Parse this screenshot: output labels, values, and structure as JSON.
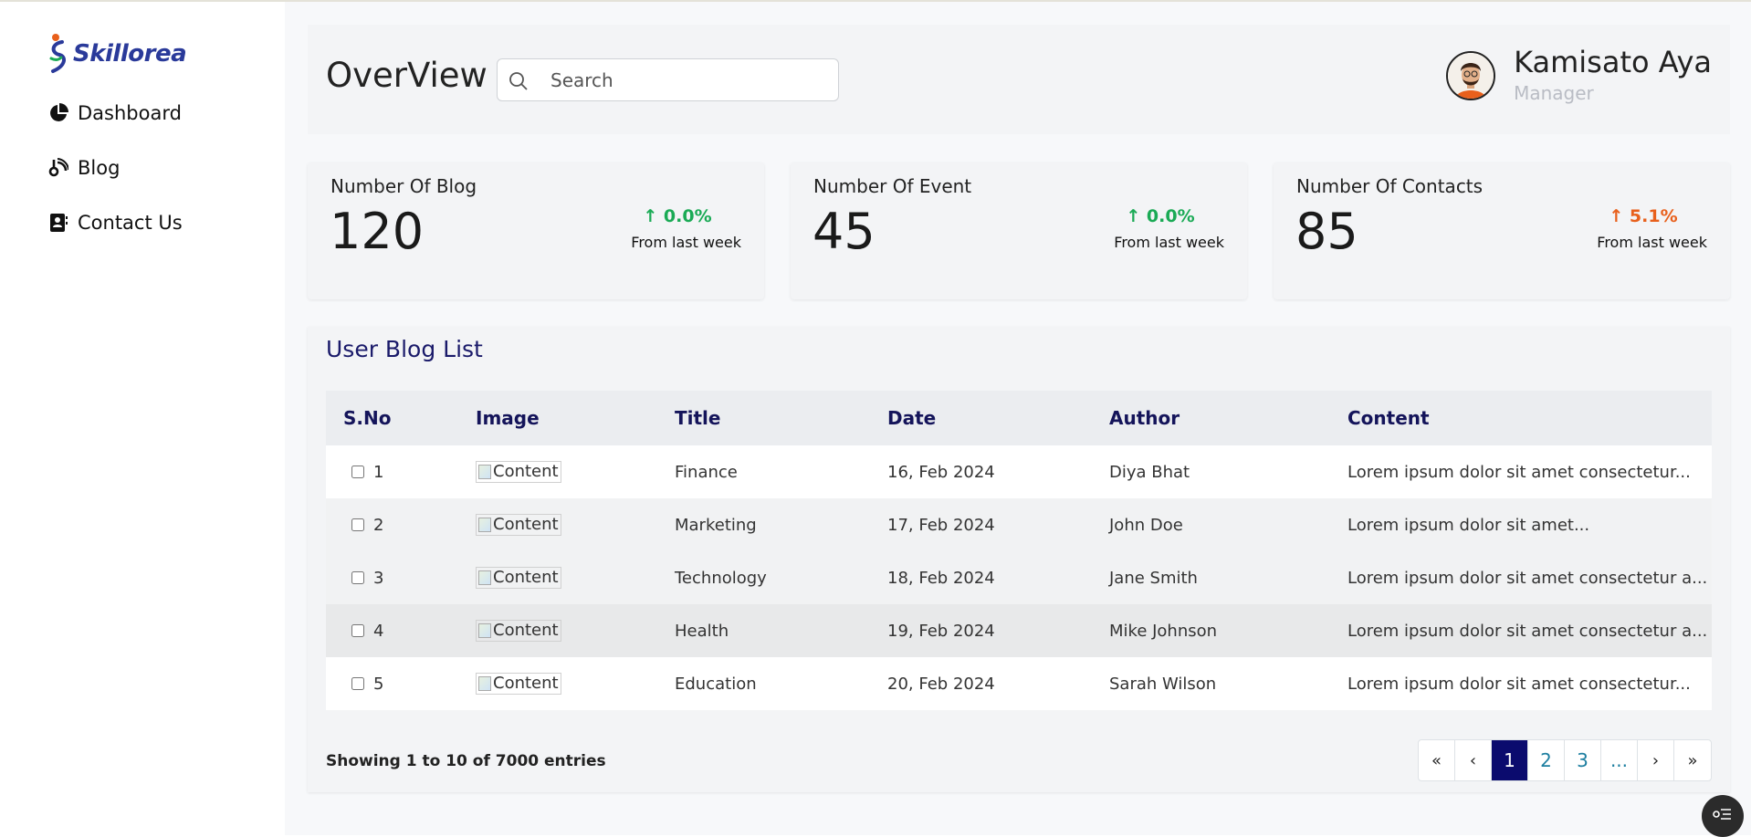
{
  "brand": {
    "logo_text": "Skillorea"
  },
  "sidebar": {
    "items": [
      {
        "label": "Dashboard",
        "icon": "pie-chart-icon"
      },
      {
        "label": "Blog",
        "icon": "blog-icon"
      },
      {
        "label": "Contact Us",
        "icon": "contact-book-icon"
      }
    ]
  },
  "header": {
    "title": "OverView",
    "search_placeholder": "Search",
    "user_name": "Kamisato Aya",
    "user_role": "Manager"
  },
  "cards": [
    {
      "title": "Number Of Blog",
      "value": "120",
      "trend": "↑ 0.0%",
      "trend_color": "#1aaa55",
      "from": "From last week"
    },
    {
      "title": "Number Of Event",
      "value": "45",
      "trend": "↑ 0.0%",
      "trend_color": "#1aaa55",
      "from": "From last week"
    },
    {
      "title": "Number Of Contacts",
      "value": "85",
      "trend": "↑ 5.1%",
      "trend_color": "#e8601c",
      "from": "From last week"
    }
  ],
  "blog_list": {
    "title": "User Blog List",
    "columns": [
      "S.No",
      "Image",
      "Title",
      "Date",
      "Author",
      "Content"
    ],
    "rows": [
      {
        "sno": "1",
        "image_alt": "Content",
        "title": "Finance",
        "date": "16, Feb 2024",
        "author": "Diya Bhat",
        "content": "Lorem ipsum dolor sit amet consectetur..."
      },
      {
        "sno": "2",
        "image_alt": "Content",
        "title": "Marketing",
        "date": "17, Feb 2024",
        "author": "John Doe",
        "content": "Lorem ipsum dolor sit amet..."
      },
      {
        "sno": "3",
        "image_alt": "Content",
        "title": "Technology",
        "date": "18, Feb 2024",
        "author": "Jane Smith",
        "content": "Lorem ipsum dolor sit amet consectetur a..."
      },
      {
        "sno": "4",
        "image_alt": "Content",
        "title": "Health",
        "date": "19, Feb 2024",
        "author": "Mike Johnson",
        "content": "Lorem ipsum dolor sit amet consectetur a..."
      },
      {
        "sno": "5",
        "image_alt": "Content",
        "title": "Education",
        "date": "20, Feb 2024",
        "author": "Sarah Wilson",
        "content": "Lorem ipsum dolor sit amet consectetur..."
      }
    ],
    "showing": "Showing 1 to 10 of 7000 entries"
  },
  "pagination": {
    "first": "«",
    "prev": "‹",
    "pages": [
      "1",
      "2",
      "3",
      "..."
    ],
    "next": "›",
    "last": "»",
    "current": "1"
  },
  "colors": {
    "accent": "#0b0b6e",
    "heading": "#14145a",
    "positive": "#1aaa55",
    "warning": "#e8601c"
  }
}
